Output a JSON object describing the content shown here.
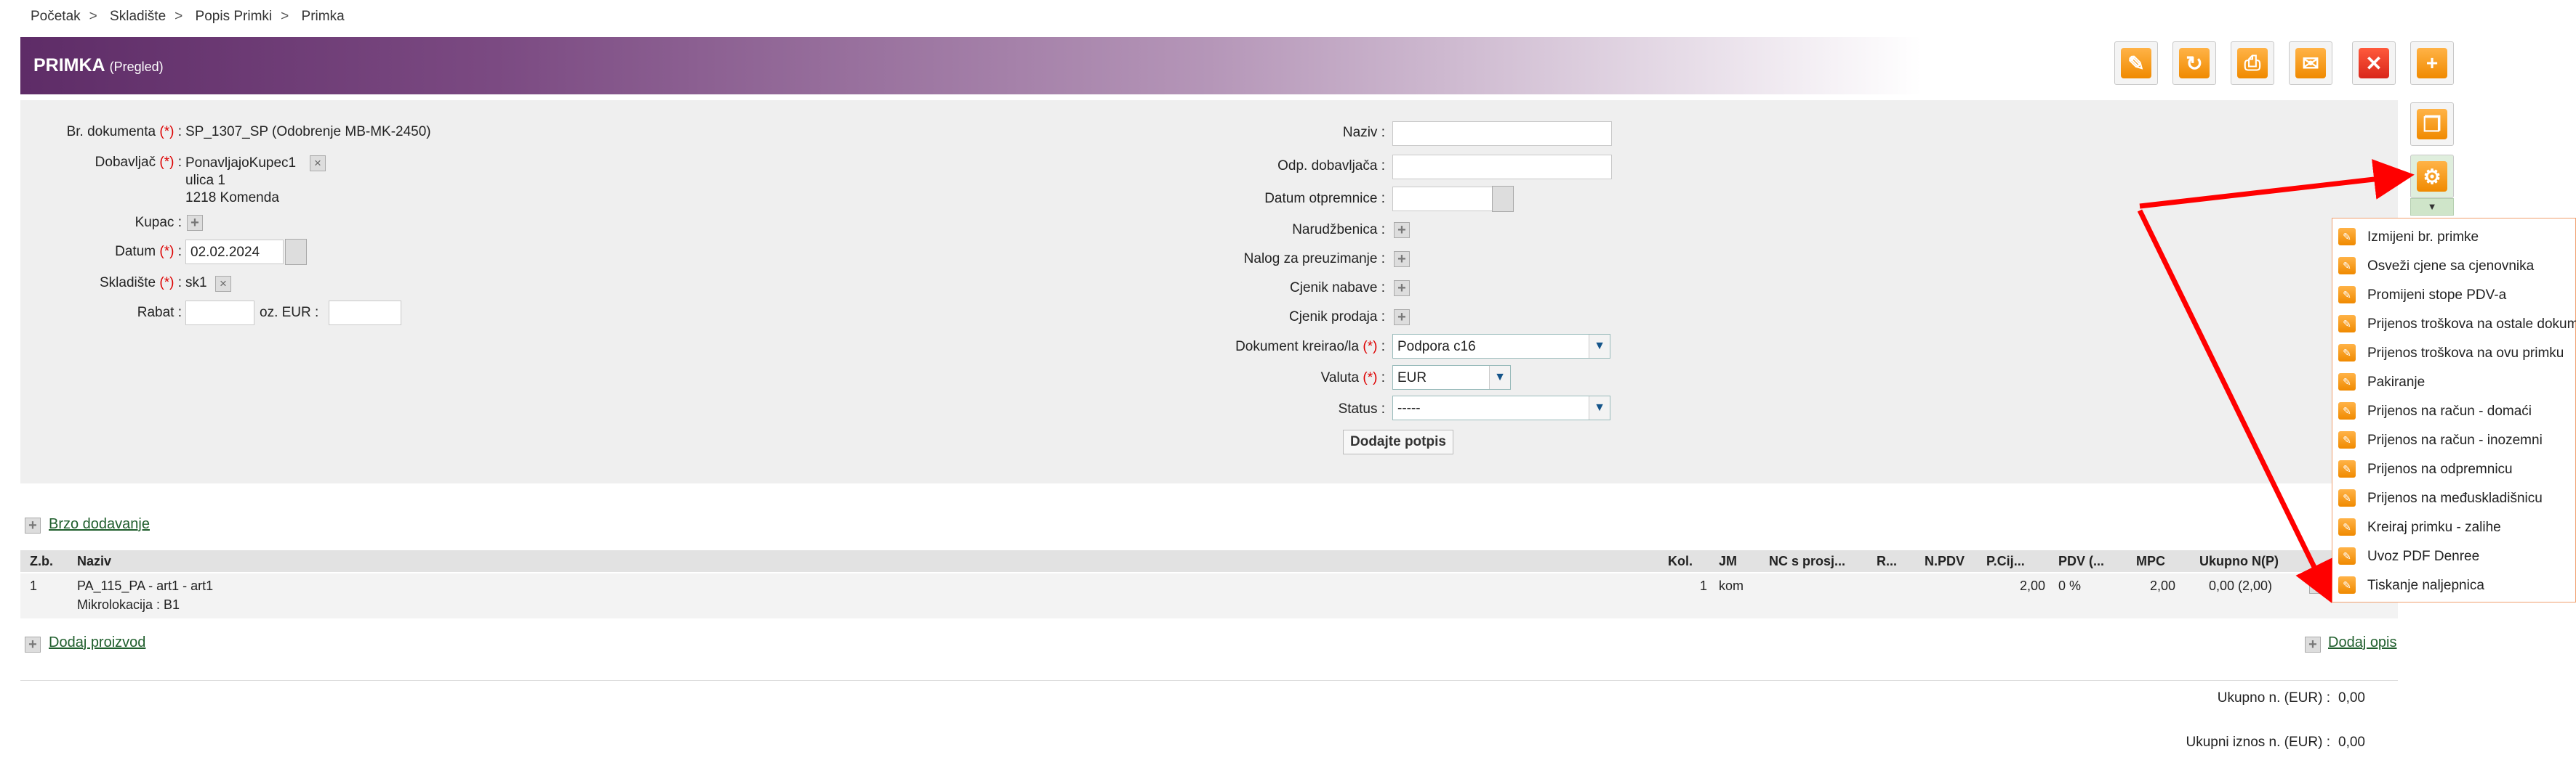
{
  "breadcrumbs": [
    "Početak",
    "Skladište",
    "Popis Primki",
    "Primka"
  ],
  "header": {
    "title": "PRIMKA",
    "subtitle": "(Pregled)"
  },
  "toolbar": {
    "edit": "✎",
    "refresh": "↻",
    "print": "⎙",
    "mail": "✉",
    "close": "✕",
    "add": "+",
    "copy": "❐",
    "settings": "⚙"
  },
  "form_left": {
    "doc_label": "Br. dokumenta",
    "doc_value": "SP_1307_SP (Odobrenje MB-MK-2450)",
    "supplier_label": "Dobavljač",
    "supplier_line1": "PonavljajoKupec1",
    "supplier_line2": "ulica 1",
    "supplier_line3": "1218 Komenda",
    "buyer_label": "Kupac :",
    "date_label": "Datum",
    "date_value": "02.02.2024",
    "warehouse_label": "Skladište",
    "warehouse_value": "sk1",
    "rabat_label": "Rabat :",
    "rabat_or": "oz. EUR :",
    "req": "(*)",
    "colon": ":"
  },
  "form_right": {
    "naziv_label": "Naziv :",
    "odp_label": "Odp. dobavljača :",
    "datum_otp_label": "Datum otpremnice :",
    "narudzbenica_label": "Narudžbenica :",
    "nalog_label": "Nalog za preuzimanje :",
    "cjenik_nabave_label": "Cjenik nabave :",
    "cjenik_prodaja_label": "Cjenik prodaja :",
    "kreirao_label": "Dokument kreirao/la",
    "kreirao_value": "Podpora c16",
    "valuta_label": "Valuta",
    "valuta_value": "EUR",
    "status_label": "Status :",
    "status_value": "-----",
    "signature_button": "Dodajte potpis"
  },
  "links": {
    "quick_add": "Brzo dodavanje",
    "add_product": "Dodaj proizvod",
    "add_desc": "Dodaj opis"
  },
  "table": {
    "columns": [
      "Z.b.",
      "Naziv",
      "Kol.",
      "JM",
      "NC s prosj...",
      "R...",
      "N.PDV",
      "P.Cij...",
      "PDV (...",
      "MPC",
      "Ukupno N(P)"
    ],
    "row": {
      "zb": "1",
      "naziv": "PA_115_PA - art1 - art1",
      "mikro": "Mikrolokacija : B1",
      "kol": "1",
      "jm": "kom",
      "pcij": "2,00",
      "pdv": "0 %",
      "mpc": "2,00",
      "ukupno": "0,00 (2,00)"
    }
  },
  "totals": {
    "ukupno_label": "Ukupno n. (EUR) :",
    "ukupno_value": "0,00",
    "iznos_label": "Ukupni iznos n. (EUR) :",
    "iznos_value": "0,00"
  },
  "dropdown_menu": [
    "Izmijeni br. primke",
    "Osveži cjene sa cjenovnika",
    "Promijeni stope PDV-a",
    "Prijenos troškova na ostale dokum.",
    "Prijenos troškova na ovu primku",
    "Pakiranje",
    "Prijenos na račun - domaći",
    "Prijenos na račun - inozemni",
    "Prijenos na odpremnicu",
    "Prijenos na međuskladišnicu",
    "Kreiraj primku - zalihe",
    "Uvoz PDF Denree",
    "Tiskanje naljepnica"
  ],
  "colors": {
    "header_purple": "#5e2c67",
    "annotation_red": "#ff0000",
    "link_green": "#1f5e2c"
  }
}
